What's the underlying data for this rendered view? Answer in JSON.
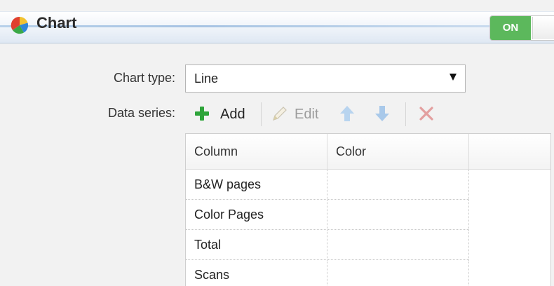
{
  "header": {
    "title": "Chart",
    "toggle_label": "ON",
    "title_icon": "chart-pie-icon"
  },
  "form": {
    "chart_type_label": "Chart type:",
    "chart_type_value": "Line",
    "data_series_label": "Data series:"
  },
  "toolbar": {
    "add_label": "Add",
    "edit_label": "Edit",
    "icons": [
      "plus-icon",
      "pencil-icon",
      "arrow-up-icon",
      "arrow-down-icon",
      "delete-x-icon"
    ]
  },
  "table": {
    "headers": [
      "Column",
      "Color"
    ],
    "rows": [
      {
        "column": "B&W pages",
        "color": ""
      },
      {
        "column": "Color Pages",
        "color": ""
      },
      {
        "column": "Total",
        "color": ""
      },
      {
        "column": "Scans",
        "color": ""
      }
    ]
  },
  "colors": {
    "toggle_on": "#5cb85c",
    "add_green": "#2ea43a",
    "delete_red": "#e08a8a",
    "arrow_blue": "#a9c9ea"
  }
}
